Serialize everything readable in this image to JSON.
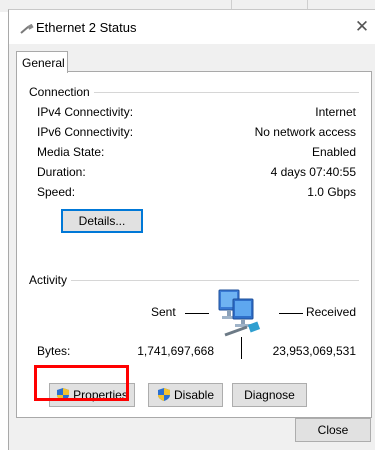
{
  "window": {
    "title": "Ethernet 2 Status",
    "close_glyph": "✕"
  },
  "tabs": [
    {
      "label": "General",
      "selected": true
    }
  ],
  "connection": {
    "group_label": "Connection",
    "rows": [
      {
        "label": "IPv4 Connectivity:",
        "value": "Internet"
      },
      {
        "label": "IPv6 Connectivity:",
        "value": "No network access"
      },
      {
        "label": "Media State:",
        "value": "Enabled"
      },
      {
        "label": "Duration:",
        "value": "4 days 07:40:55"
      },
      {
        "label": "Speed:",
        "value": "1.0 Gbps"
      }
    ],
    "details_button": "Details..."
  },
  "activity": {
    "group_label": "Activity",
    "sent_label": "Sent",
    "received_label": "Received",
    "bytes_label": "Bytes:",
    "bytes_sent": "1,741,697,668",
    "bytes_received": "23,953,069,531",
    "network_icon": "network-computers-icon"
  },
  "buttons": {
    "properties": "Properties",
    "disable": "Disable",
    "diagnose": "Diagnose",
    "close": "Close"
  },
  "colors": {
    "highlight": "#ff0000",
    "focus": "#0078d7",
    "button_face": "#e1e1e1"
  }
}
